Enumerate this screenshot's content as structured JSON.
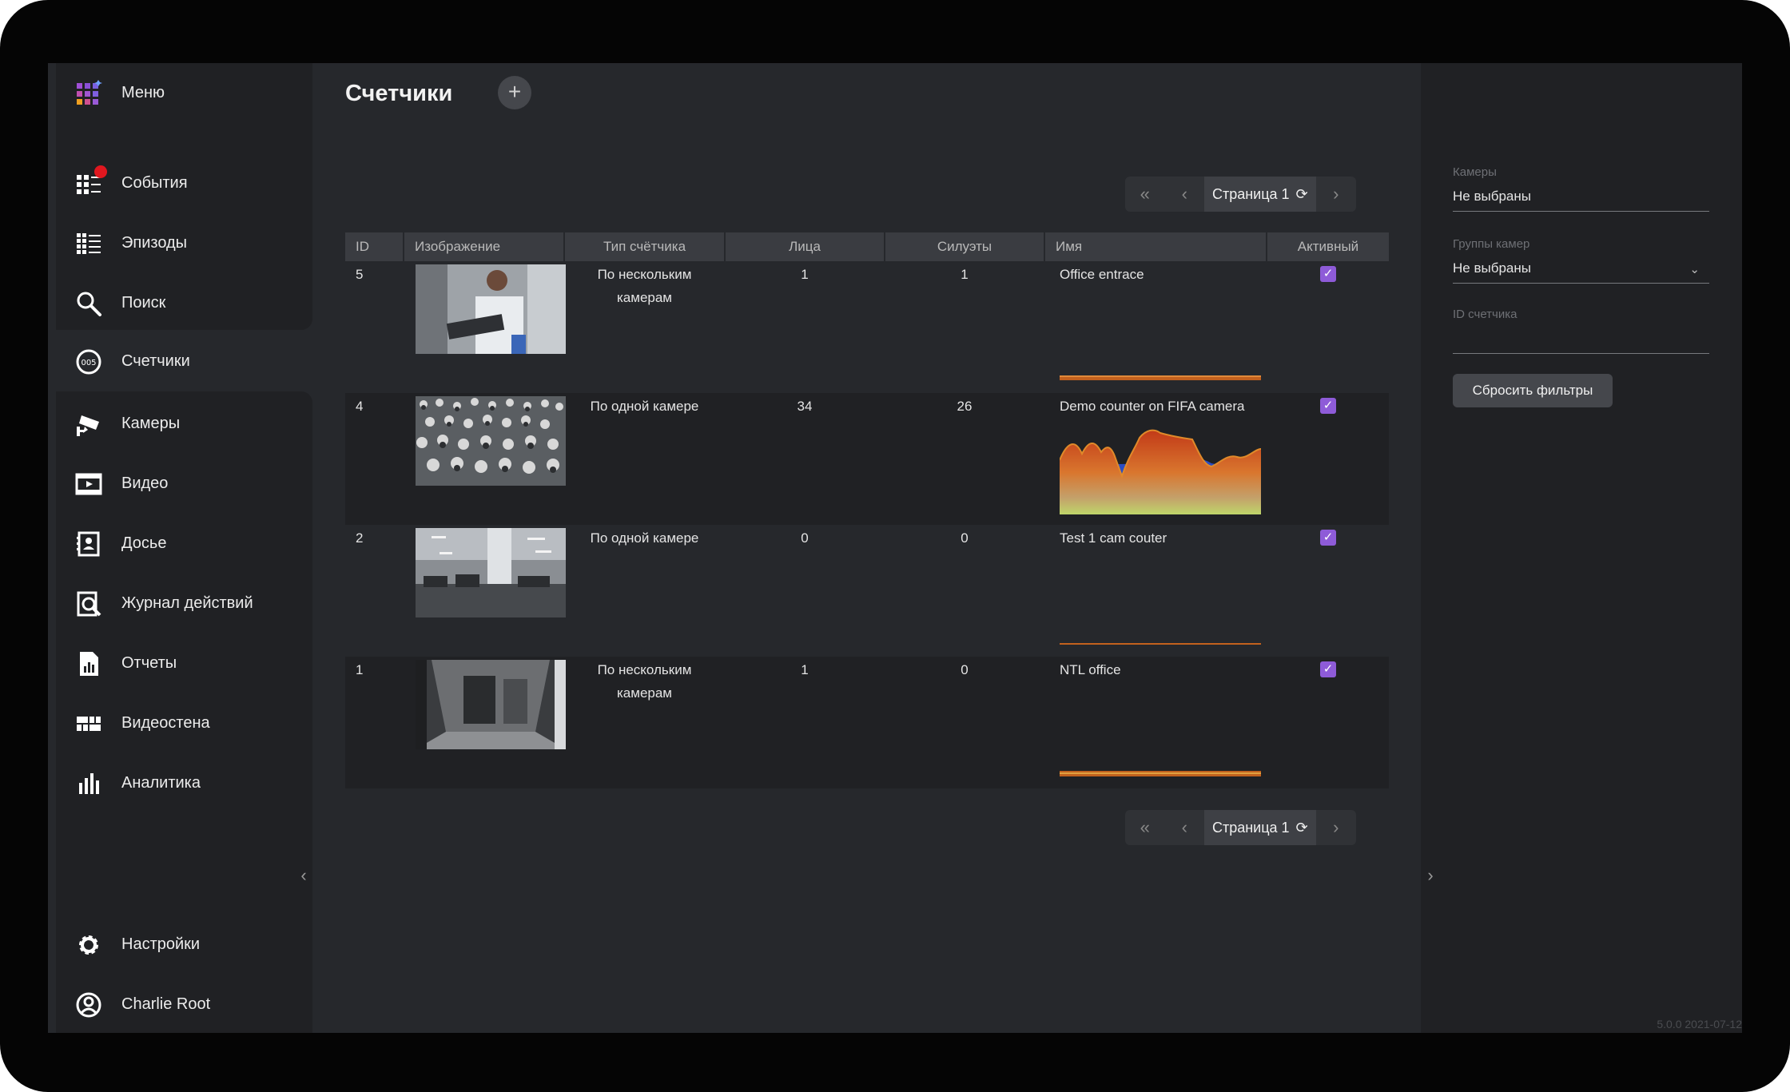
{
  "sidebar": {
    "menu": {
      "label": "Меню",
      "icon": "apps-grid-icon"
    },
    "items": [
      {
        "label": "События",
        "icon": "events-list-icon",
        "notification": true
      },
      {
        "label": "Эпизоды",
        "icon": "episodes-icon"
      },
      {
        "label": "Поиск",
        "icon": "search-icon"
      },
      {
        "label": "Счетчики",
        "icon": "counter-icon",
        "active": true
      },
      {
        "label": "Камеры",
        "icon": "camera-icon"
      },
      {
        "label": "Видео",
        "icon": "video-film-icon"
      },
      {
        "label": "Досье",
        "icon": "dossier-icon"
      },
      {
        "label": "Журнал действий",
        "icon": "audit-log-icon"
      },
      {
        "label": "Отчеты",
        "icon": "report-icon"
      },
      {
        "label": "Видеостена",
        "icon": "video-wall-icon"
      },
      {
        "label": "Аналитика",
        "icon": "analytics-icon"
      }
    ],
    "settings": {
      "label": "Настройки",
      "icon": "gear-icon"
    },
    "user": {
      "label": "Charlie Root",
      "icon": "user-icon"
    }
  },
  "main": {
    "title": "Счетчики",
    "add_label": "+",
    "pager": {
      "page_label": "Страница 1",
      "first": "«",
      "prev": "‹",
      "next": "›",
      "refresh": "⟳"
    },
    "columns": [
      "ID",
      "Изображение",
      "Тип счётчика",
      "Лица",
      "Силуэты",
      "Имя",
      "Активный"
    ],
    "rows": [
      {
        "id": "5",
        "type_line1": "По нескольким",
        "type_line2": "камерам",
        "faces": "1",
        "silhouettes": "1",
        "name": "Office entrace",
        "active": true,
        "thumb": "person-laptop"
      },
      {
        "id": "4",
        "type_line1": "По одной камере",
        "type_line2": "",
        "faces": "34",
        "silhouettes": "26",
        "name": "Demo counter on FIFA camera",
        "active": true,
        "thumb": "crowd"
      },
      {
        "id": "2",
        "type_line1": "По одной камере",
        "type_line2": "",
        "faces": "0",
        "silhouettes": "0",
        "name": "Test 1 cam couter",
        "active": true,
        "thumb": "office-hall"
      },
      {
        "id": "1",
        "type_line1": "По нескольким",
        "type_line2": "камерам",
        "faces": "1",
        "silhouettes": "0",
        "name": "NTL office",
        "active": true,
        "thumb": "corridor"
      }
    ]
  },
  "filters": {
    "cameras": {
      "label": "Камеры",
      "value": "Не выбраны"
    },
    "camera_groups": {
      "label": "Группы камер",
      "value": "Не выбраны"
    },
    "counter_id": {
      "label": "ID счетчика",
      "value": ""
    },
    "reset_label": "Сбросить фильтры"
  },
  "version": "5.0.0 2021-07-12",
  "colors": {
    "accent": "#8e5bd8",
    "notification": "#e0171f",
    "background": "#26282c",
    "panel": "#202124"
  }
}
